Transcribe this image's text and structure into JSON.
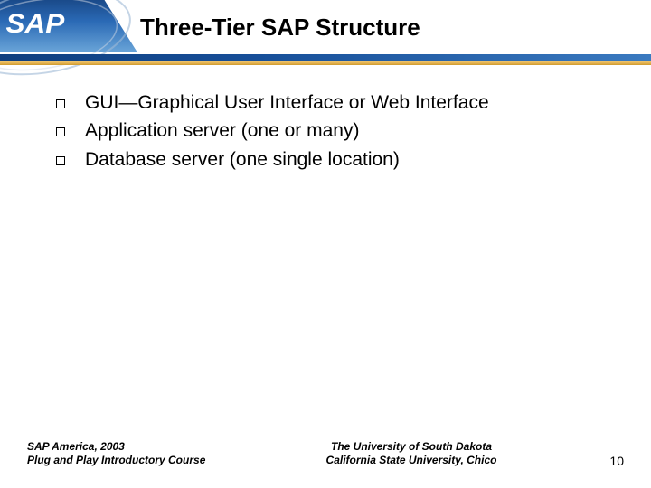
{
  "header": {
    "logo_text": "SAP",
    "title": "Three-Tier SAP Structure"
  },
  "bullets": [
    "GUI—Graphical User Interface or Web Interface",
    "Application server (one or many)",
    "Database server (one single location)"
  ],
  "footer": {
    "left_line1": "SAP America, 2003",
    "left_line2": "Plug and Play Introductory Course",
    "center_line1": "The University of South Dakota",
    "center_line2": "California State University, Chico",
    "page_number": "10"
  }
}
